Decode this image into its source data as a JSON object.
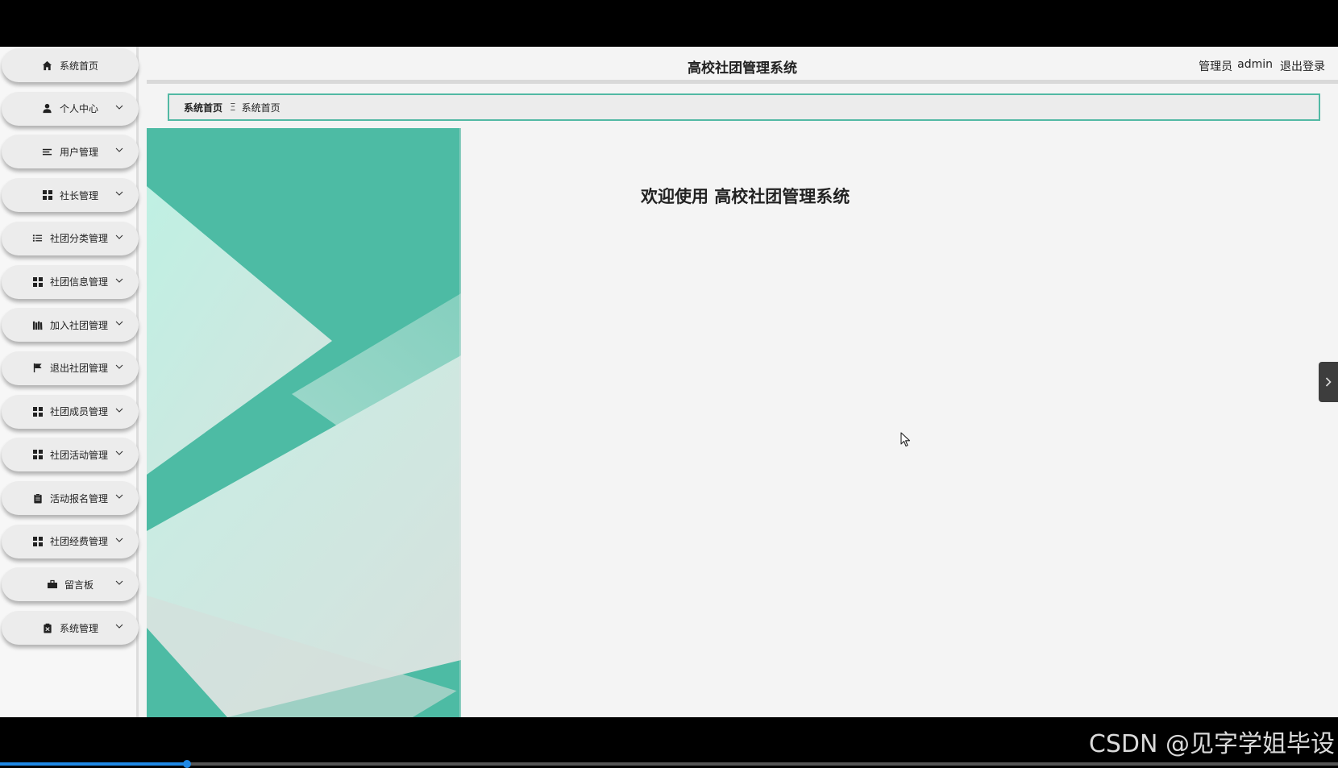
{
  "header": {
    "title": "高校社团管理系统",
    "role_label": "管理员",
    "username": "admin",
    "logout_label": "退出登录"
  },
  "sidebar": {
    "items": [
      {
        "label": "系统首页",
        "icon": "home-icon",
        "has_submenu": false
      },
      {
        "label": "个人中心",
        "icon": "user-icon",
        "has_submenu": true
      },
      {
        "label": "用户管理",
        "icon": "list-lines-icon",
        "has_submenu": true
      },
      {
        "label": "社长管理",
        "icon": "grid-icon",
        "has_submenu": true
      },
      {
        "label": "社团分类管理",
        "icon": "list-icon",
        "has_submenu": true
      },
      {
        "label": "社团信息管理",
        "icon": "grid-icon",
        "has_submenu": true
      },
      {
        "label": "加入社团管理",
        "icon": "books-icon",
        "has_submenu": true
      },
      {
        "label": "退出社团管理",
        "icon": "flag-icon",
        "has_submenu": true
      },
      {
        "label": "社团成员管理",
        "icon": "grid-icon",
        "has_submenu": true
      },
      {
        "label": "社团活动管理",
        "icon": "grid-icon",
        "has_submenu": true
      },
      {
        "label": "活动报名管理",
        "icon": "clipboard-icon",
        "has_submenu": true
      },
      {
        "label": "社团经费管理",
        "icon": "grid-icon",
        "has_submenu": true
      },
      {
        "label": "留言板",
        "icon": "message-icon",
        "has_submenu": true
      },
      {
        "label": "系统管理",
        "icon": "settings-doc-icon",
        "has_submenu": true
      }
    ]
  },
  "breadcrumb": {
    "home": "系统首页",
    "separator": "Ξ",
    "current": "系统首页"
  },
  "main": {
    "welcome": "欢迎使用 高校社团管理系统"
  },
  "watermark": "CSDN @见字学姐毕设",
  "video_progress": 0.14,
  "colors": {
    "accent": "#52b9a4",
    "banner_teal": "#4dbba4",
    "banner_light": "#bdeee2"
  }
}
